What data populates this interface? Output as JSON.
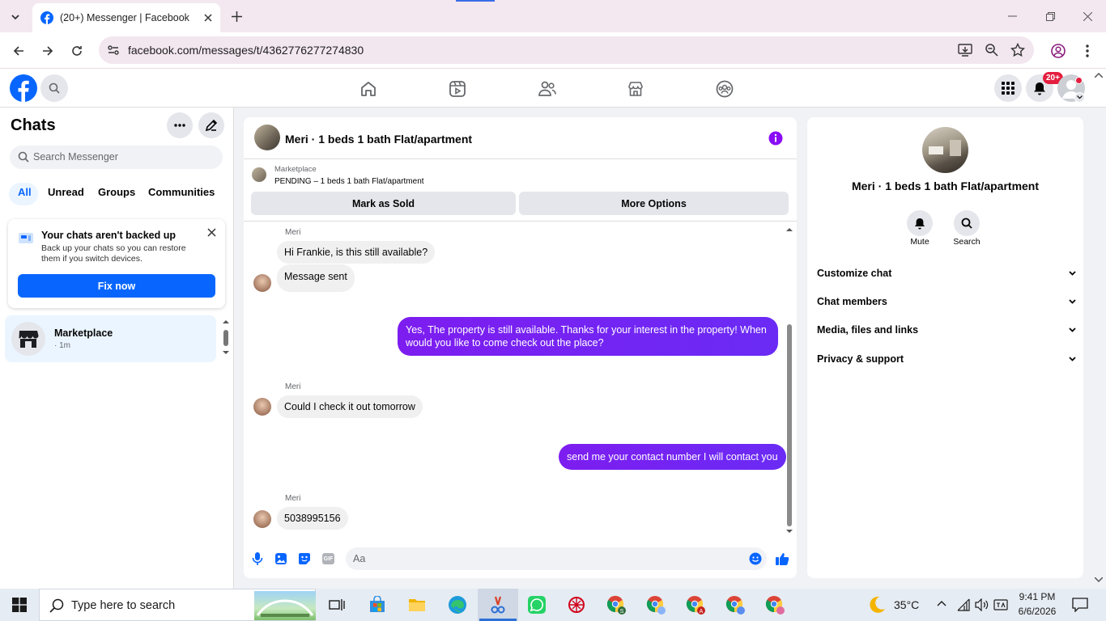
{
  "browser": {
    "tab_title": "(20+) Messenger | Facebook",
    "url": "facebook.com/messages/t/4362776277274830"
  },
  "fbnav": {
    "notif_badge": "20+"
  },
  "left": {
    "title": "Chats",
    "search_placeholder": "Search Messenger",
    "filters": [
      "All",
      "Unread",
      "Groups",
      "Communities"
    ],
    "backup": {
      "title": "Your chats aren't backed up",
      "body": "Back up your chats so you can restore them if you switch devices.",
      "button": "Fix now"
    },
    "conversations": [
      {
        "name": "Marketplace",
        "time": "· 1m"
      }
    ]
  },
  "chat": {
    "header_title": "Meri · 1 beds 1 bath Flat/apartment",
    "listing_source": "Marketplace",
    "listing_status": "PENDING – 1 beds 1 bath Flat/apartment",
    "mark_sold": "Mark as Sold",
    "more_options": "More Options",
    "messages": {
      "m1_sender": "Meri",
      "m1_text": "Hi Frankie, is this still available?",
      "m2_text": "Message sent",
      "m3_text": "Yes, The property is still available. Thanks for your interest in the property! When would you like to come check out the place?",
      "m4_sender": "Meri",
      "m4_text": "Could I check it out tomorrow",
      "m5_text": "send me your contact number I will contact you",
      "m6_sender": "Meri",
      "m6_text": "5038995156"
    },
    "composer_placeholder": "Aa",
    "gif_label": "GIF"
  },
  "info": {
    "title": "Meri · 1 beds 1 bath Flat/apartment",
    "mute": "Mute",
    "search": "Search",
    "sections": [
      "Customize chat",
      "Chat members",
      "Media, files and links",
      "Privacy & support"
    ]
  },
  "taskbar": {
    "search_placeholder": "Type here to search",
    "temperature": "35°C",
    "time": "9:41 PM",
    "date": "6/6/2026"
  },
  "colors": {
    "fb_blue": "#0866ff",
    "accent_purple": "#8a0df5"
  }
}
